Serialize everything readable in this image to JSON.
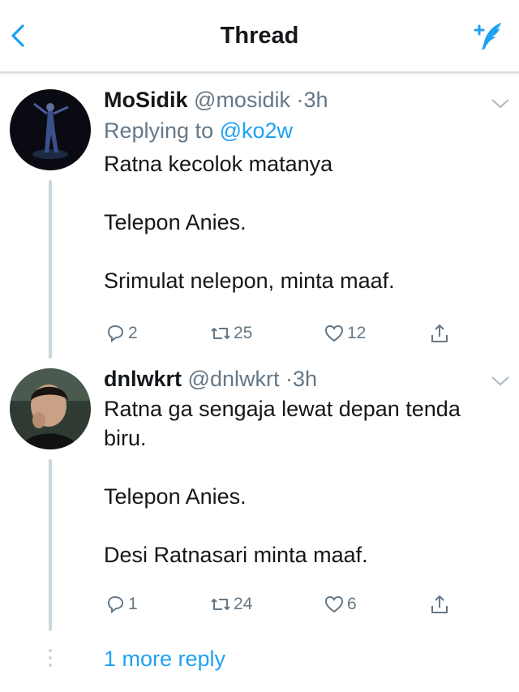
{
  "header": {
    "title": "Thread",
    "back_icon": "chevron-left-icon",
    "compose_icon": "compose-tweet-icon",
    "accent_color": "#1da1f2"
  },
  "tweets": [
    {
      "name": "MoSidik",
      "handle": "@mosidik",
      "separator": "·",
      "time": "3h",
      "replying_prefix": "Replying to",
      "replying_to": "@ko2w",
      "paragraphs": [
        "Ratna kecolok matanya",
        "Telepon Anies.",
        "Srimulat nelepon, minta maaf."
      ],
      "replies": "2",
      "retweets": "25",
      "likes": "12"
    },
    {
      "name": "dnlwkrt",
      "handle": "@dnlwkrt",
      "separator": "·",
      "time": "3h",
      "paragraphs": [
        "Ratna ga sengaja lewat depan tenda biru.",
        "Telepon Anies.",
        "Desi Ratnasari minta maaf."
      ],
      "replies": "1",
      "retweets": "24",
      "likes": "6"
    }
  ],
  "more_reply": "1 more reply",
  "colors": {
    "text": "#14171a",
    "secondary": "#657786",
    "link": "#1da1f2",
    "thread_line": "#ccd6dd"
  }
}
